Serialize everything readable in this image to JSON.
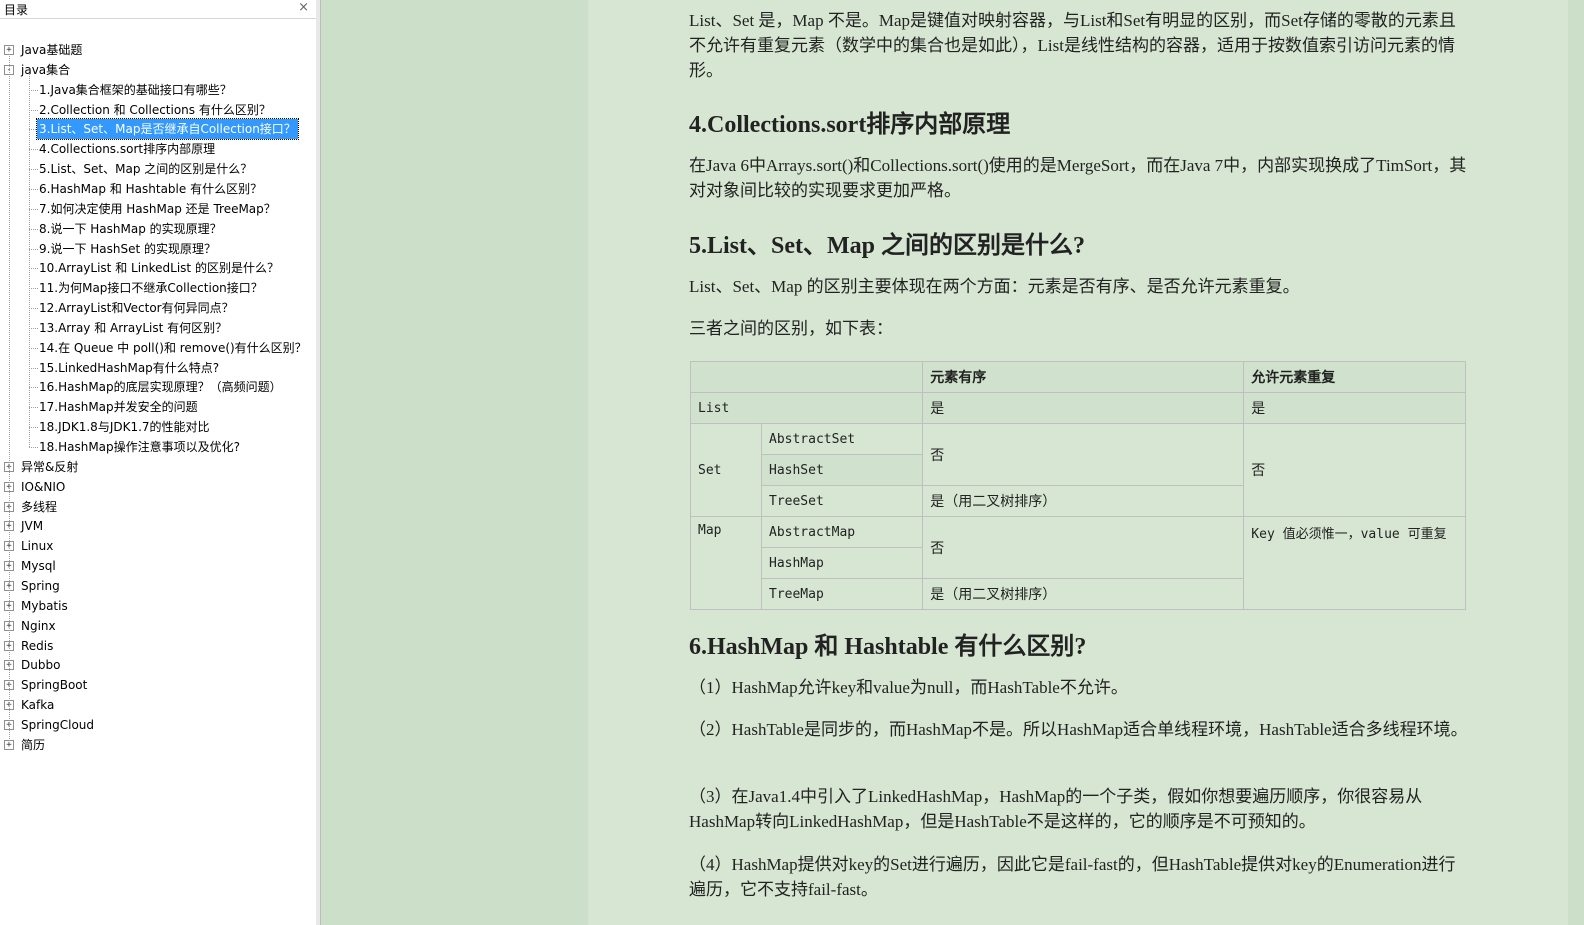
{
  "toc": {
    "title": "目录",
    "close_glyph": "×",
    "nodes": [
      {
        "label": "Java基础题",
        "level": 0,
        "expander": "+"
      },
      {
        "label": "java集合",
        "level": 0,
        "expander": "-"
      },
      {
        "label": "1.Java集合框架的基础接口有哪些？",
        "level": 1
      },
      {
        "label": "2.Collection 和 Collections 有什么区别？",
        "level": 1
      },
      {
        "label": "3.List、Set、Map是否继承自Collection接口？",
        "level": 1,
        "selected": true
      },
      {
        "label": "4.Collections.sort排序内部原理",
        "level": 1
      },
      {
        "label": "5.List、Set、Map 之间的区别是什么？",
        "level": 1
      },
      {
        "label": "6.HashMap 和 Hashtable 有什么区别？",
        "level": 1
      },
      {
        "label": "7.如何决定使用 HashMap 还是 TreeMap？",
        "level": 1
      },
      {
        "label": "8.说一下 HashMap 的实现原理？",
        "level": 1
      },
      {
        "label": "9.说一下 HashSet 的实现原理？",
        "level": 1
      },
      {
        "label": "10.ArrayList 和 LinkedList 的区别是什么？",
        "level": 1
      },
      {
        "label": "11.为何Map接口不继承Collection接口？",
        "level": 1
      },
      {
        "label": "12.ArrayList和Vector有何异同点？",
        "level": 1
      },
      {
        "label": "13.Array 和 ArrayList 有何区别？",
        "level": 1
      },
      {
        "label": "14.在 Queue 中 poll()和 remove()有什么区别？",
        "level": 1
      },
      {
        "label": "15.LinkedHashMap有什么特点?",
        "level": 1
      },
      {
        "label": "16.HashMap的底层实现原理？（高频问题）",
        "level": 1
      },
      {
        "label": "17.HashMap并发安全的问题",
        "level": 1
      },
      {
        "label": "18.JDK1.8与JDK1.7的性能对比",
        "level": 1
      },
      {
        "label": "18.HashMap操作注意事项以及优化?",
        "level": 1
      },
      {
        "label": "异常&反射",
        "level": 0,
        "expander": "+"
      },
      {
        "label": "IO&NIO",
        "level": 0,
        "expander": "+"
      },
      {
        "label": "多线程",
        "level": 0,
        "expander": "+"
      },
      {
        "label": "JVM",
        "level": 0,
        "expander": "+"
      },
      {
        "label": "Linux",
        "level": 0,
        "expander": "+"
      },
      {
        "label": "Mysql",
        "level": 0,
        "expander": "+"
      },
      {
        "label": "Spring",
        "level": 0,
        "expander": "+"
      },
      {
        "label": "Mybatis",
        "level": 0,
        "expander": "+"
      },
      {
        "label": "Nginx",
        "level": 0,
        "expander": "+"
      },
      {
        "label": "Redis",
        "level": 0,
        "expander": "+"
      },
      {
        "label": "Dubbo",
        "level": 0,
        "expander": "+"
      },
      {
        "label": "SpringBoot",
        "level": 0,
        "expander": "+"
      },
      {
        "label": "Kafka",
        "level": 0,
        "expander": "+"
      },
      {
        "label": "SpringCloud",
        "level": 0,
        "expander": "+"
      },
      {
        "label": "简历",
        "level": 0,
        "expander": "+"
      }
    ]
  },
  "doc": {
    "p1": "List、Set 是，Map 不是。Map是键值对映射容器，与List和Set有明显的区别，而Set存储的零散的元素且不允许有重复元素（数学中的集合也是如此），List是线性结构的容器，适用于按数值索引访问元素的情形。",
    "h4": "4.Collections.sort排序内部原理",
    "p2": "在Java 6中Arrays.sort()和Collections.sort()使用的是MergeSort，而在Java 7中，内部实现换成了TimSort，其对对象间比较的实现要求更加严格。",
    "h5": "5.List、Set、Map 之间的区别是什么?",
    "p3": "List、Set、Map 的区别主要体现在两个方面：元素是否有序、是否允许元素重复。",
    "p4": "三者之间的区别，如下表：",
    "table": {
      "head_ordered": "元素有序",
      "head_dup": "允许元素重复",
      "list": "List",
      "list_ordered": "是",
      "list_dup": "是",
      "set": "Set",
      "abstract_set": "AbstractSet",
      "hash_set": "HashSet",
      "tree_set": "TreeSet",
      "set_ordered_no": "否",
      "set_ordered_tree": "是（用二叉树排序）",
      "set_dup": "否",
      "map": "Map",
      "abstract_map": "AbstractMap",
      "hash_map": "HashMap",
      "tree_map": "TreeMap",
      "map_ordered_no": "否",
      "map_ordered_tree": "是（用二叉树排序）",
      "map_dup": "Key 值必须惟一，value 可重复"
    },
    "h6": "6.HashMap 和 Hashtable 有什么区别?",
    "q1": "（1）HashMap允许key和value为null，而HashTable不允许。",
    "q2": "（2）HashTable是同步的，而HashMap不是。所以HashMap适合单线程环境，HashTable适合多线程环境。",
    "q3": "（3）在Java1.4中引入了LinkedHashMap，HashMap的一个子类，假如你想要遍历顺序，你很容易从HashMap转向LinkedHashMap，但是HashTable不是这样的，它的顺序是不可预知的。",
    "q4": "（4）HashMap提供对key的Set进行遍历，因此它是fail-fast的，但HashTable提供对key的Enumeration进行遍历，它不支持fail-fast。"
  }
}
